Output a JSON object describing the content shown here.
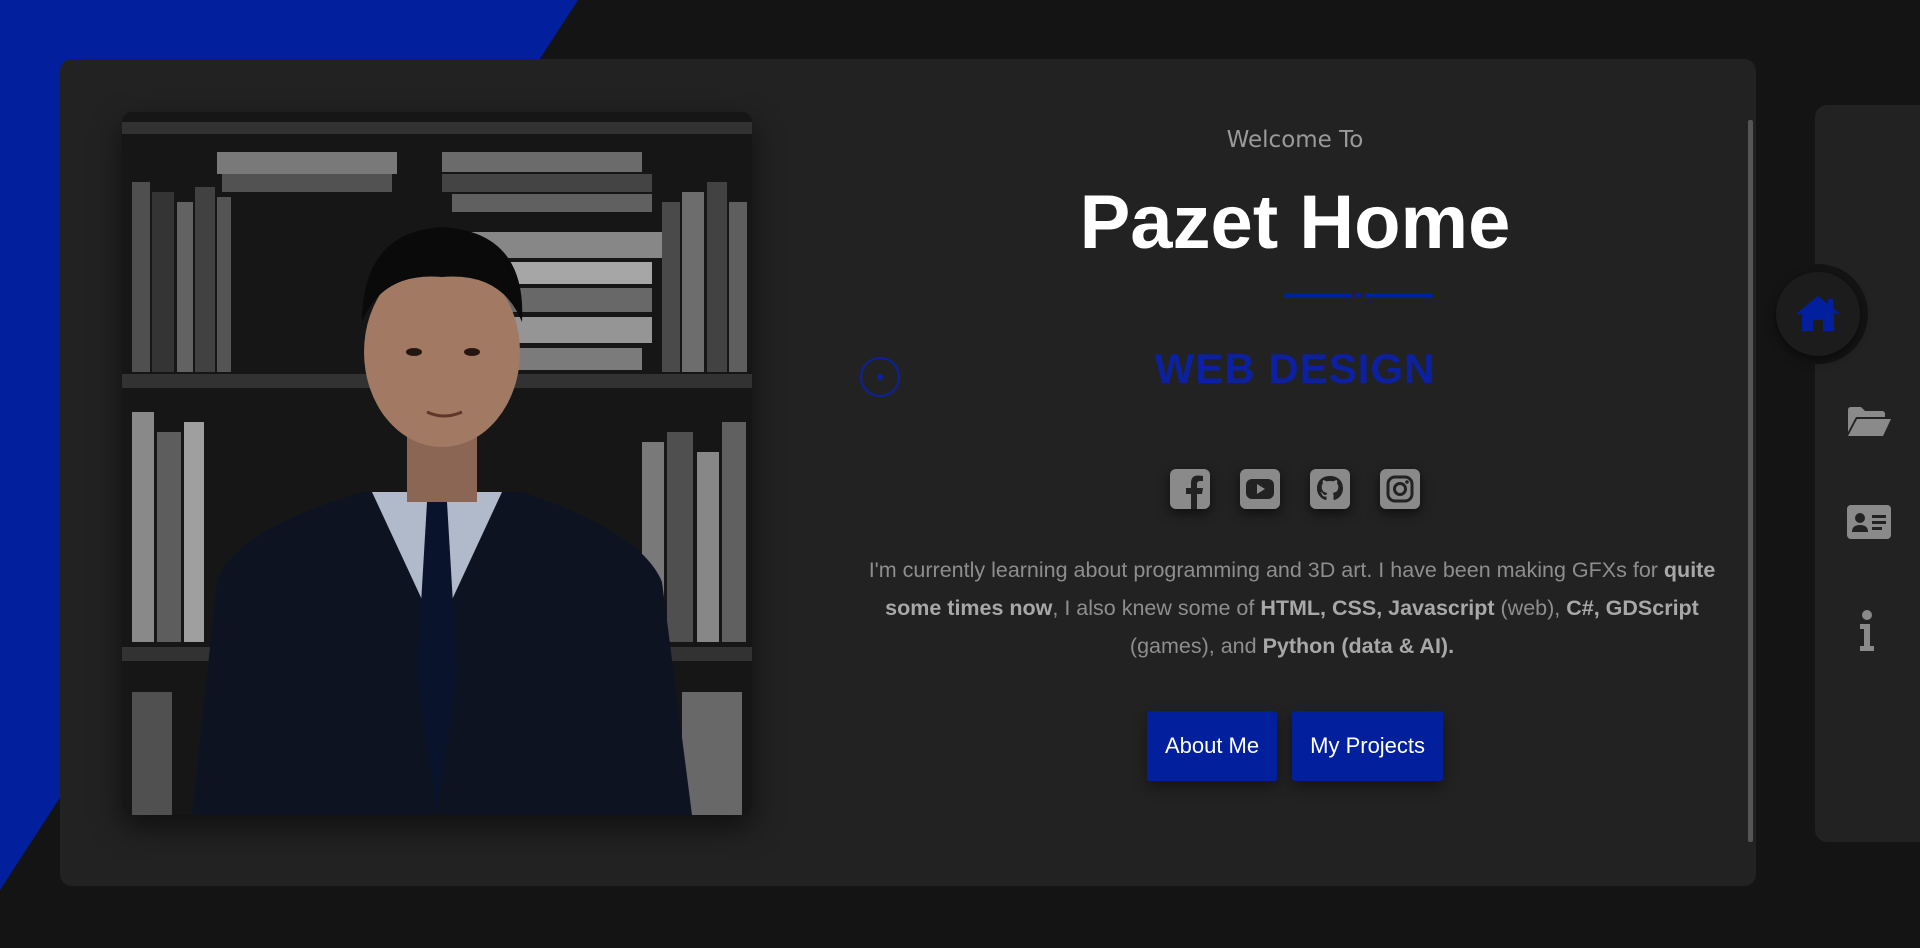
{
  "hero": {
    "welcome": "Welcome To",
    "title": "Pazet Home",
    "subtitle": "WEB DESIGN"
  },
  "profile_photo": {
    "alt": "Portrait photo of a young man in a suit in front of a bookshelf"
  },
  "socials": [
    {
      "name": "facebook-icon"
    },
    {
      "name": "youtube-icon"
    },
    {
      "name": "github-icon"
    },
    {
      "name": "instagram-icon"
    }
  ],
  "description": {
    "part1": "I'm currently learning about programming and 3D art. I have been making GFXs for ",
    "bold1": "quite some times now",
    "part2": ", I also knew some of ",
    "bold2": "HTML, CSS, Javascript",
    "part3": " (web), ",
    "bold3": "C#, GDScript",
    "part4": " (games), and ",
    "bold4": "Python (data & AI)."
  },
  "buttons": {
    "about": "About Me",
    "projects": "My Projects"
  },
  "side_nav": {
    "items": [
      {
        "icon": "home-icon",
        "active": true
      },
      {
        "icon": "folder-open-icon",
        "active": false
      },
      {
        "icon": "id-card-icon",
        "active": false
      },
      {
        "icon": "info-icon",
        "active": false
      }
    ]
  },
  "colors": {
    "accent": "#02209d",
    "background": "#141414",
    "card": "#222222"
  }
}
